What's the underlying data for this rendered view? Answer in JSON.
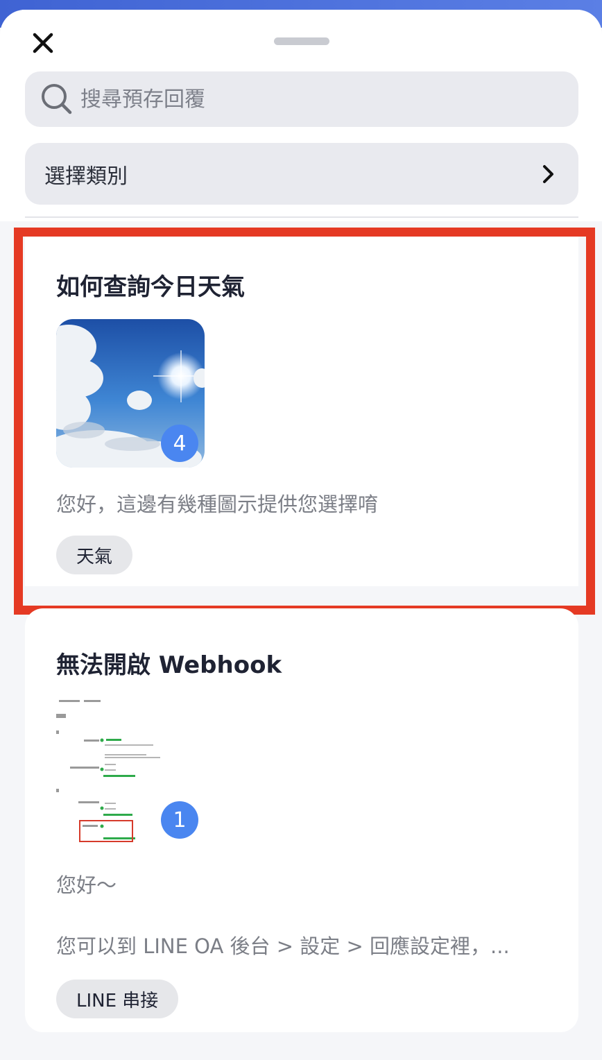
{
  "search": {
    "placeholder": "搜尋預存回覆"
  },
  "category": {
    "label": "選擇類別"
  },
  "cards": [
    {
      "title": "如何查詢今日天氣",
      "image_count": "4",
      "text": "您好，這邊有幾種圖示提供您選擇唷",
      "tag": "天氣"
    },
    {
      "title": "無法開啟 Webhook",
      "image_count": "1",
      "text_line1": "您好～",
      "text_line2": "您可以到 LINE OA 後台 > 設定 > 回應設定裡，...",
      "tag": "LINE 串接"
    }
  ],
  "colors": {
    "accent": "#4a86f0",
    "highlight": "#e53a24",
    "top_bar": "#4a6ddc"
  },
  "icons": {
    "close": "close-icon",
    "search": "search-icon",
    "chevron": "chevron-right-icon"
  }
}
